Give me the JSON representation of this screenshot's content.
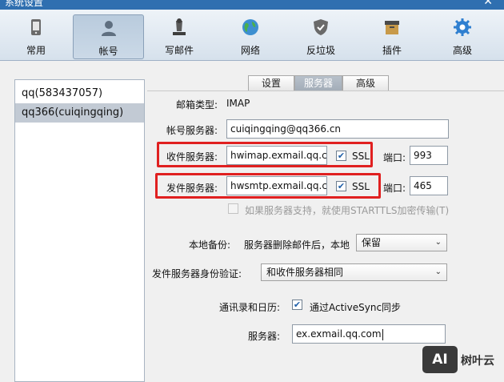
{
  "window": {
    "title": "系统设置"
  },
  "toolbar": {
    "items": [
      {
        "label": "常用",
        "icon": "phone-icon"
      },
      {
        "label": "帐号",
        "icon": "user-icon",
        "active": true
      },
      {
        "label": "写邮件",
        "icon": "compose-icon"
      },
      {
        "label": "网络",
        "icon": "globe-icon"
      },
      {
        "label": "反垃圾",
        "icon": "shield-icon"
      },
      {
        "label": "插件",
        "icon": "box-icon"
      },
      {
        "label": "高级",
        "icon": "gear-icon"
      }
    ]
  },
  "accounts": [
    {
      "label": "qq(583437057)"
    },
    {
      "label": "qq366(cuiqingqing)",
      "selected": true
    }
  ],
  "tabs": [
    {
      "label": "设置"
    },
    {
      "label": "服务器",
      "active": true
    },
    {
      "label": "高级"
    }
  ],
  "form": {
    "mail_type_label": "邮箱类型:",
    "mail_type_value": "IMAP",
    "account_server_label": "帐号服务器:",
    "account_server_value": "cuiqingqing@qq366.cn",
    "incoming_label": "收件服务器:",
    "incoming_value": "hwimap.exmail.qq.cc",
    "incoming_ssl_label": "SSL",
    "incoming_ssl_checked": true,
    "incoming_port_label": "端口:",
    "incoming_port_value": "993",
    "outgoing_label": "发件服务器:",
    "outgoing_value": "hwsmtp.exmail.qq.cc",
    "outgoing_ssl_label": "SSL",
    "outgoing_ssl_checked": true,
    "outgoing_port_label": "端口:",
    "outgoing_port_value": "465",
    "starttls_label": "如果服务器支持，就使用STARTTLS加密传输(T)",
    "starttls_checked": false,
    "backup_label": "本地备份:",
    "backup_desc": "服务器删除邮件后，本地",
    "backup_value": "保留",
    "auth_label": "发件服务器身份验证:",
    "auth_value": "和收件服务器相同",
    "contacts_label": "通讯录和日历:",
    "activesync_label": "通过ActiveSync同步",
    "activesync_checked": true,
    "server_label": "服务器:",
    "server_value": "ex.exmail.qq.com"
  },
  "watermark": {
    "logo_text": "AI",
    "brand_text": "树叶云"
  },
  "colors": {
    "highlight": "#e02020",
    "selection": "#c2cad4",
    "titlebar": "#2f6fb0",
    "check": "#1f5fa8"
  }
}
